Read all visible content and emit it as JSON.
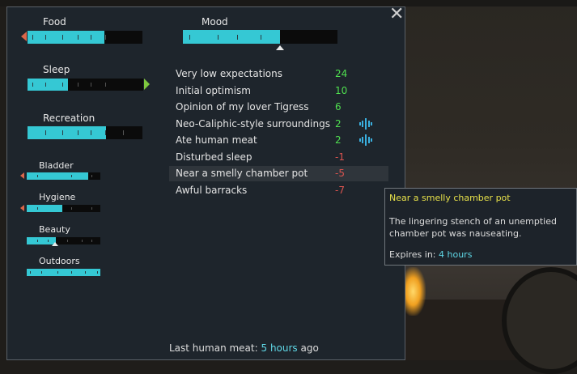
{
  "close_glyph": "✕",
  "needs": {
    "food": {
      "label": "Food",
      "level": 0.67
    },
    "sleep": {
      "label": "Sleep",
      "level": 0.35
    },
    "recreation": {
      "label": "Recreation",
      "level": 0.68
    },
    "bladder": {
      "label": "Bladder",
      "level": 0.83
    },
    "hygiene": {
      "label": "Hygiene",
      "level": 0.48
    },
    "beauty": {
      "label": "Beauty",
      "level": 0.4
    },
    "outdoors": {
      "label": "Outdoors",
      "level": 1.0
    }
  },
  "mood": {
    "label": "Mood",
    "level": 0.63
  },
  "thoughts": [
    {
      "label": "Very low expectations",
      "value": "24",
      "sign": "pos",
      "icon": ""
    },
    {
      "label": "Initial optimism",
      "value": "10",
      "sign": "pos",
      "icon": ""
    },
    {
      "label": "Opinion of my lover Tigress",
      "value": "6",
      "sign": "pos",
      "icon": ""
    },
    {
      "label": "Neo-Caliphic-style surroundings",
      "value": "2",
      "sign": "pos",
      "icon": "ideology-icon"
    },
    {
      "label": "Ate human meat",
      "value": "2",
      "sign": "pos",
      "icon": "ideology-icon"
    },
    {
      "label": "Disturbed sleep",
      "value": "-1",
      "sign": "neg",
      "icon": ""
    },
    {
      "label": "Near a smelly chamber pot",
      "value": "-5",
      "sign": "neg",
      "icon": ""
    },
    {
      "label": "Awful barracks",
      "value": "-7",
      "sign": "neg",
      "icon": ""
    }
  ],
  "tooltip": {
    "title": "Near a smelly chamber pot",
    "description": "The lingering stench of an unemptied chamber pot was nauseating.",
    "expires_label": "Expires in:",
    "expires_value": "4 hours"
  },
  "footer": {
    "prefix": "Last human meat:",
    "value": "5 hours",
    "suffix": "ago"
  },
  "colors": {
    "bar_fill": "#35c8d4",
    "positive": "#4fdf4f",
    "negative": "#d9534f",
    "tooltip_title": "#e6e04a",
    "highlight": "#5fd7e6"
  }
}
